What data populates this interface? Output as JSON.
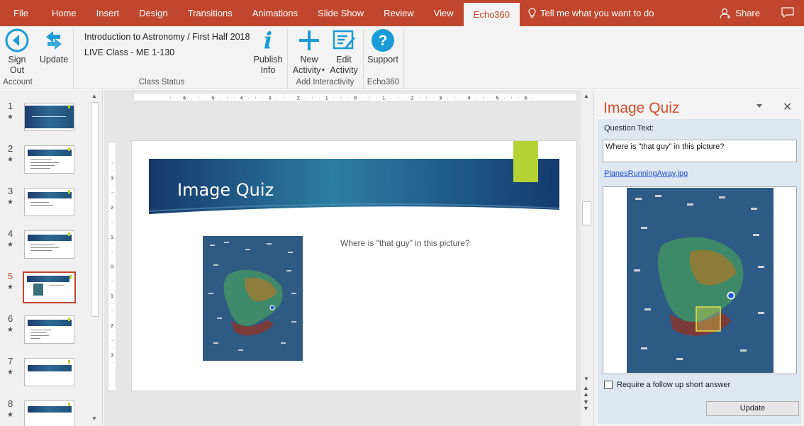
{
  "ribbon_tabs": [
    "File",
    "Home",
    "Insert",
    "Design",
    "Transitions",
    "Animations",
    "Slide Show",
    "Review",
    "View",
    "Echo360"
  ],
  "active_tab": "Echo360",
  "tell_me": "Tell me what you want to do",
  "share_label": "Share",
  "ribbon": {
    "sign_out_line1": "Sign",
    "sign_out_line2": "Out",
    "update_label": "Update",
    "class_name": "Introduction to Astronomy / First Half 2018",
    "class_section": "LIVE Class - ME 1-130",
    "publish_line1": "Publish",
    "publish_line2": "Info",
    "new_line1": "New",
    "new_line2": "Activity",
    "edit_line1": "Edit",
    "edit_line2": "Activity",
    "support_label": "Support",
    "group_account": "Account",
    "group_class_status": "Class Status",
    "group_add_interactivity": "Add Interactivity",
    "group_echo360": "Echo360"
  },
  "slides": [
    {
      "num": "1",
      "star": "★"
    },
    {
      "num": "2",
      "star": "★"
    },
    {
      "num": "3",
      "star": "★"
    },
    {
      "num": "4",
      "star": "★"
    },
    {
      "num": "5",
      "star": "★"
    },
    {
      "num": "6",
      "star": "★"
    },
    {
      "num": "7",
      "star": "★"
    },
    {
      "num": "8",
      "star": "★"
    }
  ],
  "active_slide": 5,
  "ruler_h": [
    "6",
    "5",
    "4",
    "3",
    "2",
    "1",
    "0",
    "1",
    "2",
    "3",
    "4",
    "5",
    "6"
  ],
  "ruler_v": [
    "3",
    "2",
    "1",
    "0",
    "1",
    "2",
    "3"
  ],
  "slide": {
    "title": "Image Quiz",
    "question": "Where is \"that guy\" in this picture?"
  },
  "pane": {
    "title": "Image Quiz",
    "close_glyph": "✕",
    "question_label": "Question Text:",
    "question_value": "Where is \"that guy\" in this picture?",
    "file_link": "PlanesRunningAway.jpg",
    "followup_label": "Require a follow up short answer",
    "update_button": "Update"
  },
  "colors": {
    "accent": "#c0462d",
    "pane_title": "#d04d2f",
    "echo_blue": "#1a9bd7",
    "green_tab": "#b5d335"
  }
}
